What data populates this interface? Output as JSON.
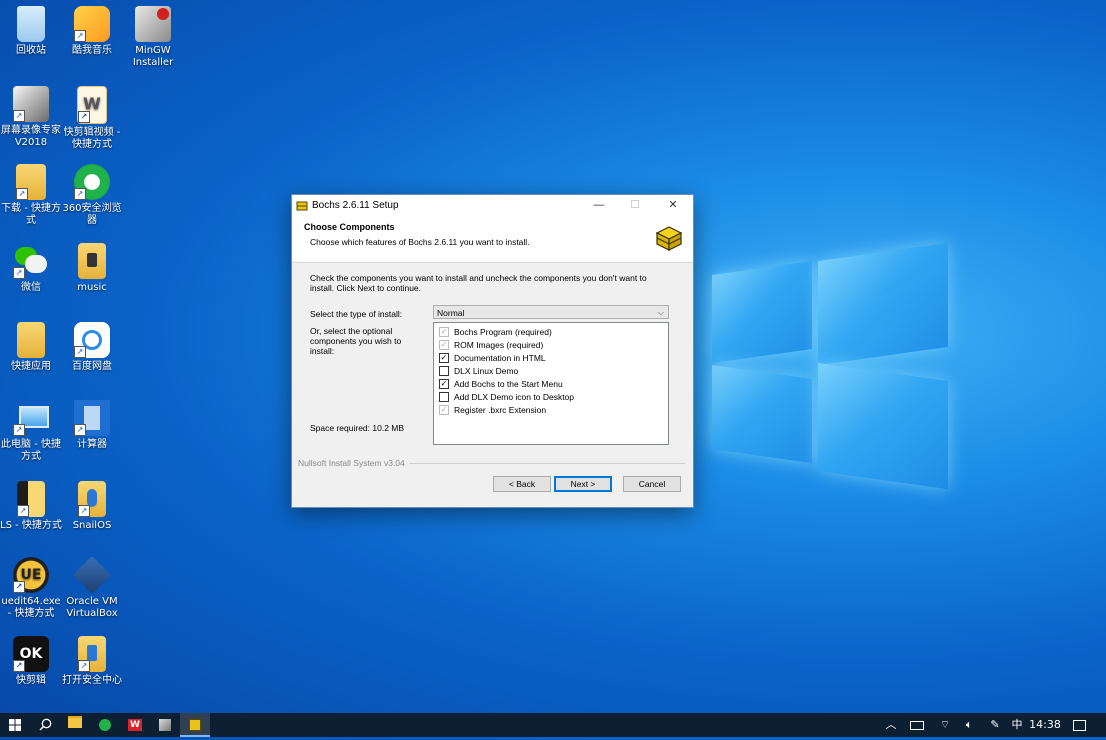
{
  "desktop": {
    "icons": [
      {
        "label": "回收站"
      },
      {
        "label": "酷我音乐"
      },
      {
        "label": "MinGW Installer"
      },
      {
        "label": "屏幕录像专家 V2018"
      },
      {
        "label": "快剪辑视频 - 快捷方式"
      },
      {
        "label": "下载 - 快捷方式"
      },
      {
        "label": "360安全浏览器"
      },
      {
        "label": "微信"
      },
      {
        "label": "music"
      },
      {
        "label": "快捷应用"
      },
      {
        "label": "百度网盘"
      },
      {
        "label": "此电脑 - 快捷方式"
      },
      {
        "label": "计算器"
      },
      {
        "label": "LS - 快捷方式"
      },
      {
        "label": "SnailOS"
      },
      {
        "label": "uedit64.exe - 快捷方式"
      },
      {
        "label": "Oracle VM VirtualBox"
      },
      {
        "label": "快剪辑"
      },
      {
        "label": "打开安全中心"
      }
    ]
  },
  "dialog": {
    "title": "Bochs 2.6.11 Setup",
    "header_title": "Choose Components",
    "header_subtitle": "Choose which features of Bochs 2.6.11 you want to install.",
    "description": "Check the components you want to install and uncheck the components you don't want to install. Click Next to continue.",
    "install_type_label": "Select the type of install:",
    "install_type_value": "Normal",
    "optional_label": "Or, select the optional components you wish to install:",
    "space_required": "Space required: 10.2 MB",
    "components": [
      {
        "label": "Bochs Program (required)",
        "checked": true,
        "disabled": true
      },
      {
        "label": "ROM Images (required)",
        "checked": true,
        "disabled": true
      },
      {
        "label": "Documentation in HTML",
        "checked": true,
        "disabled": false
      },
      {
        "label": "DLX Linux Demo",
        "checked": false,
        "disabled": false
      },
      {
        "label": "Add Bochs to the Start Menu",
        "checked": true,
        "disabled": false
      },
      {
        "label": "Add DLX Demo icon to Desktop",
        "checked": false,
        "disabled": false
      },
      {
        "label": "Register .bxrc Extension",
        "checked": true,
        "disabled": true
      }
    ],
    "nsis_label": "Nullsoft Install System v3.04",
    "back_label": "< Back",
    "next_label": "Next >",
    "cancel_label": "Cancel",
    "minimize_glyph": "—",
    "maximize_glyph": "☐",
    "close_glyph": "✕"
  },
  "taskbar": {
    "ime": "中",
    "time": "14:38"
  },
  "colors": {
    "accent": "#0078d7",
    "taskbar": "#0d1f33"
  }
}
